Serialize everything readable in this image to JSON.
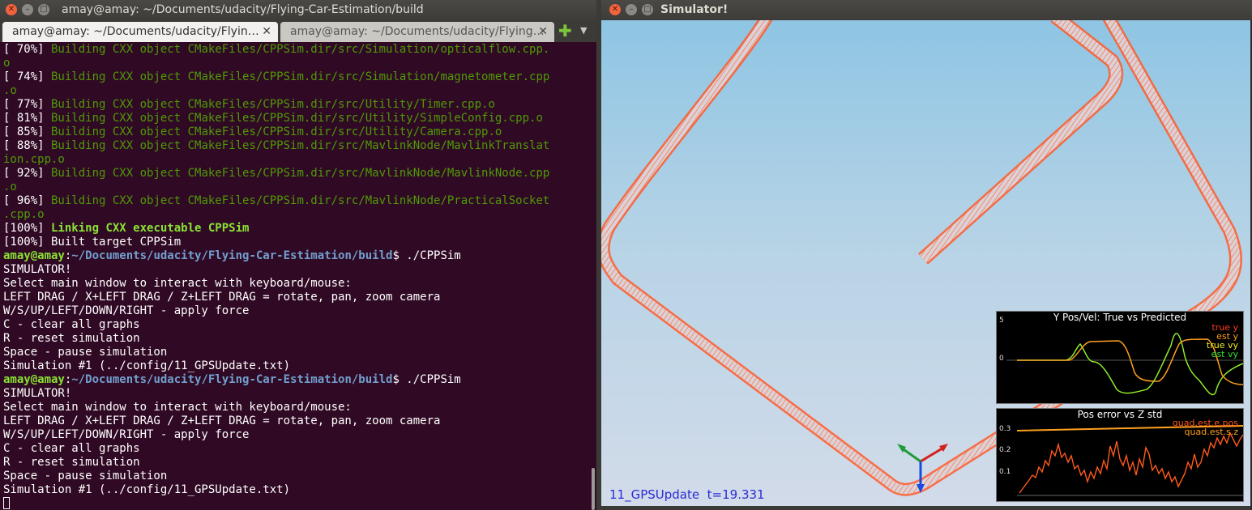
{
  "terminal": {
    "window_title": "amay@amay: ~/Documents/udacity/Flying-Car-Estimation/build",
    "tabs": [
      {
        "label": "amay@amay: ~/Documents/udacity/Flyin…",
        "close": "✕"
      },
      {
        "label": "amay@amay: ~/Documents/udacity/Flying…",
        "close": "✕"
      }
    ],
    "add_tab": "✚",
    "menu": "▼",
    "lines": [
      {
        "type": "build",
        "pct": "[ 70%]",
        "text": " Building CXX object CMakeFiles/CPPSim.dir/src/Simulation/opticalflow.cpp."
      },
      {
        "type": "cont",
        "text": "o"
      },
      {
        "type": "build",
        "pct": "[ 74%]",
        "text": " Building CXX object CMakeFiles/CPPSim.dir/src/Simulation/magnetometer.cpp"
      },
      {
        "type": "cont",
        "text": ".o"
      },
      {
        "type": "build",
        "pct": "[ 77%]",
        "text": " Building CXX object CMakeFiles/CPPSim.dir/src/Utility/Timer.cpp.o"
      },
      {
        "type": "build",
        "pct": "[ 81%]",
        "text": " Building CXX object CMakeFiles/CPPSim.dir/src/Utility/SimpleConfig.cpp.o"
      },
      {
        "type": "build",
        "pct": "[ 85%]",
        "text": " Building CXX object CMakeFiles/CPPSim.dir/src/Utility/Camera.cpp.o"
      },
      {
        "type": "build",
        "pct": "[ 88%]",
        "text": " Building CXX object CMakeFiles/CPPSim.dir/src/MavlinkNode/MavlinkTranslat"
      },
      {
        "type": "cont",
        "text": "ion.cpp.o"
      },
      {
        "type": "build",
        "pct": "[ 92%]",
        "text": " Building CXX object CMakeFiles/CPPSim.dir/src/MavlinkNode/MavlinkNode.cpp"
      },
      {
        "type": "cont",
        "text": ".o"
      },
      {
        "type": "build",
        "pct": "[ 96%]",
        "text": " Building CXX object CMakeFiles/CPPSim.dir/src/MavlinkNode/PracticalSocket"
      },
      {
        "type": "cont",
        "text": ".cpp.o"
      },
      {
        "type": "link",
        "pct": "[100%]",
        "text": " Linking CXX executable CPPSim"
      },
      {
        "type": "plain",
        "text": "[100%] Built target CPPSim"
      },
      {
        "type": "prompt",
        "user": "amay@amay",
        "sep": ":",
        "path": "~/Documents/udacity/Flying-Car-Estimation/build",
        "cmd": "$ ./CPPSim"
      },
      {
        "type": "plain",
        "text": "SIMULATOR!"
      },
      {
        "type": "plain",
        "text": "Select main window to interact with keyboard/mouse:"
      },
      {
        "type": "plain",
        "text": "LEFT DRAG / X+LEFT DRAG / Z+LEFT DRAG = rotate, pan, zoom camera"
      },
      {
        "type": "plain",
        "text": "W/S/UP/LEFT/DOWN/RIGHT - apply force"
      },
      {
        "type": "plain",
        "text": "C - clear all graphs"
      },
      {
        "type": "plain",
        "text": "R - reset simulation"
      },
      {
        "type": "plain",
        "text": "Space - pause simulation"
      },
      {
        "type": "plain",
        "text": "Simulation #1 (../config/11_GPSUpdate.txt)"
      },
      {
        "type": "prompt",
        "user": "amay@amay",
        "sep": ":",
        "path": "~/Documents/udacity/Flying-Car-Estimation/build",
        "cmd": "$ ./CPPSim"
      },
      {
        "type": "plain",
        "text": "SIMULATOR!"
      },
      {
        "type": "plain",
        "text": "Select main window to interact with keyboard/mouse:"
      },
      {
        "type": "plain",
        "text": "LEFT DRAG / X+LEFT DRAG / Z+LEFT DRAG = rotate, pan, zoom camera"
      },
      {
        "type": "plain",
        "text": "W/S/UP/LEFT/DOWN/RIGHT - apply force"
      },
      {
        "type": "plain",
        "text": "C - clear all graphs"
      },
      {
        "type": "plain",
        "text": "R - reset simulation"
      },
      {
        "type": "plain",
        "text": "Space - pause simulation"
      },
      {
        "type": "plain",
        "text": "Simulation #1 (../config/11_GPSUpdate.txt)"
      },
      {
        "type": "cursor",
        "text": ""
      }
    ]
  },
  "simulator": {
    "window_title": "Simulator!",
    "scenario": "11_GPSUpdate",
    "time_label": "t=19.331",
    "graph1": {
      "title": "Y Pos/Vel: True vs Predicted",
      "yticks": [
        "5",
        "0"
      ],
      "legend": [
        {
          "label": "true y",
          "color": "#ff3b1f"
        },
        {
          "label": "est y",
          "color": "#ffa020"
        },
        {
          "label": "true vy",
          "color": "#f0f020"
        },
        {
          "label": "est vy",
          "color": "#33e033"
        }
      ]
    },
    "graph2": {
      "title": "Pos error vs Z std",
      "yticks": [
        "0.3",
        "0.2",
        "0.1"
      ],
      "legend": [
        {
          "label": "quad.est.e.pos",
          "color": "#ff5a1a"
        },
        {
          "label": "quad.est.s.z",
          "color": "#ffa020"
        }
      ]
    }
  },
  "colors": {
    "terminal_bg": "#300a24",
    "build_green": "#4e9a06",
    "prompt_user": "#8ae234",
    "prompt_path": "#729fcf",
    "trajectory": "#ff5a2a",
    "sky_top": "#8ec5e3",
    "sky_bottom": "#d2dbe9"
  }
}
